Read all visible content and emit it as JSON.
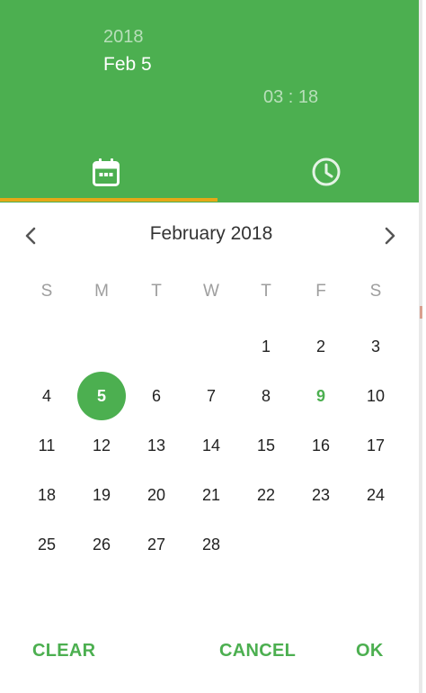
{
  "header": {
    "year": "2018",
    "date": "Feb 5",
    "time": "03 : 18"
  },
  "tabs": [
    {
      "name": "date-tab",
      "icon": "calendar-icon",
      "active": true
    },
    {
      "name": "time-tab",
      "icon": "clock-icon",
      "active": false
    }
  ],
  "colors": {
    "primary": "#4caf50",
    "tab_indicator": "#e6a817",
    "text": "#222222",
    "weekday": "#9e9e9e"
  },
  "calendar": {
    "month_label": "February 2018",
    "weekdays": [
      "S",
      "M",
      "T",
      "W",
      "T",
      "F",
      "S"
    ],
    "first_weekday_index": 4,
    "days": [
      "1",
      "2",
      "3",
      "4",
      "5",
      "6",
      "7",
      "8",
      "9",
      "10",
      "11",
      "12",
      "13",
      "14",
      "15",
      "16",
      "17",
      "18",
      "19",
      "20",
      "21",
      "22",
      "23",
      "24",
      "25",
      "26",
      "27",
      "28"
    ],
    "selected_day": "5",
    "today_day": "9"
  },
  "actions": {
    "clear": "CLEAR",
    "cancel": "CANCEL",
    "ok": "OK"
  }
}
